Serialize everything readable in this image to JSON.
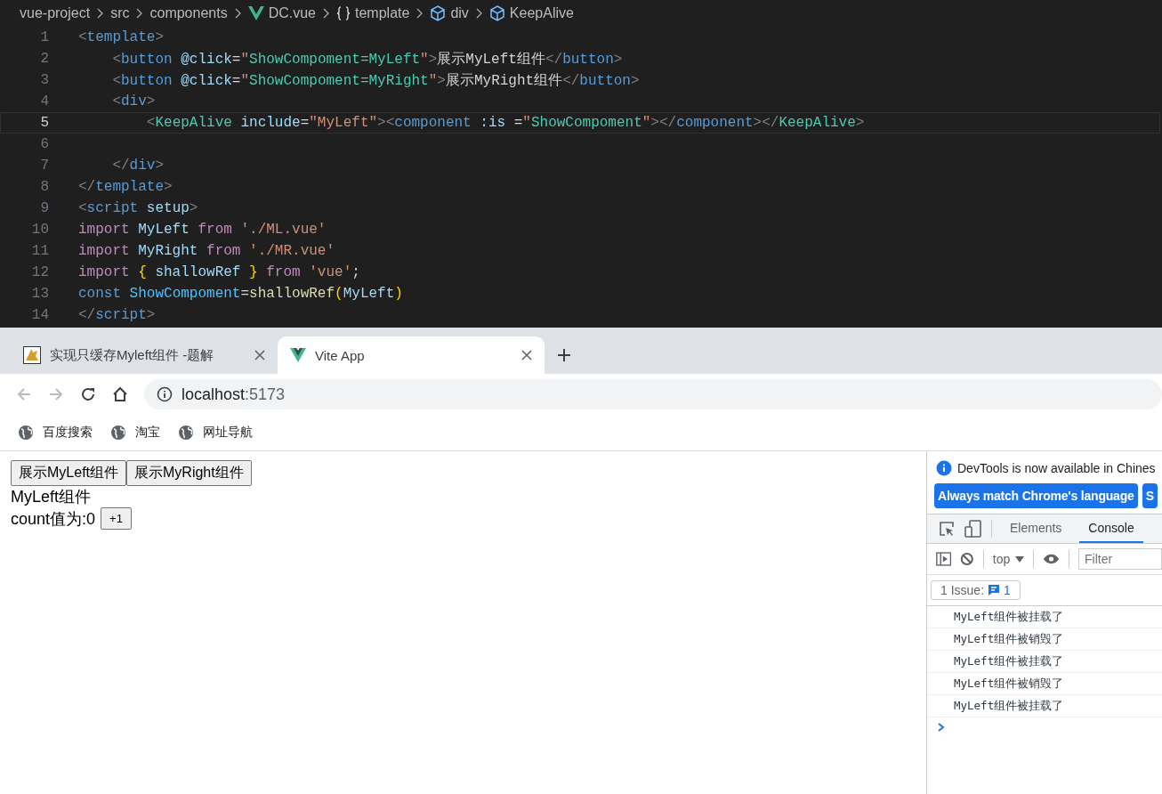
{
  "editor": {
    "breadcrumbs": [
      {
        "label": "vue-project",
        "kind": "folder"
      },
      {
        "label": "src",
        "kind": "folder"
      },
      {
        "label": "components",
        "kind": "folder"
      },
      {
        "label": "DC.vue",
        "kind": "vue"
      },
      {
        "label": "template",
        "kind": "braces"
      },
      {
        "label": "div",
        "kind": "cube"
      },
      {
        "label": "KeepAlive",
        "kind": "cube"
      }
    ],
    "lines": [
      {
        "number": "1",
        "current": false,
        "tokens": [
          {
            "kind": "punct",
            "text": "<"
          },
          {
            "kind": "tag",
            "text": "template"
          },
          {
            "kind": "punct",
            "text": ">"
          }
        ]
      },
      {
        "number": "2",
        "current": false,
        "tokens": [
          {
            "kind": "punct",
            "text": "    <"
          },
          {
            "kind": "tag",
            "text": "button"
          },
          {
            "kind": "attr",
            "text": " @click"
          },
          {
            "kind": "text",
            "text": "="
          },
          {
            "kind": "string",
            "text": "\""
          },
          {
            "kind": "expr",
            "text": "ShowCompoment=MyLeft"
          },
          {
            "kind": "string",
            "text": "\""
          },
          {
            "kind": "punct",
            "text": ">"
          },
          {
            "kind": "text",
            "text": "展示MyLeft组件"
          },
          {
            "kind": "punct",
            "text": "</"
          },
          {
            "kind": "tag",
            "text": "button"
          },
          {
            "kind": "punct",
            "text": ">"
          }
        ]
      },
      {
        "number": "3",
        "current": false,
        "tokens": [
          {
            "kind": "punct",
            "text": "    <"
          },
          {
            "kind": "tag",
            "text": "button"
          },
          {
            "kind": "attr",
            "text": " @click"
          },
          {
            "kind": "text",
            "text": "="
          },
          {
            "kind": "string",
            "text": "\""
          },
          {
            "kind": "expr",
            "text": "ShowCompoment=MyRight"
          },
          {
            "kind": "string",
            "text": "\""
          },
          {
            "kind": "punct",
            "text": ">"
          },
          {
            "kind": "text",
            "text": "展示MyRight组件"
          },
          {
            "kind": "punct",
            "text": "</"
          },
          {
            "kind": "tag",
            "text": "button"
          },
          {
            "kind": "punct",
            "text": ">"
          }
        ]
      },
      {
        "number": "4",
        "current": false,
        "tokens": [
          {
            "kind": "punct",
            "text": "    <"
          },
          {
            "kind": "tag",
            "text": "div"
          },
          {
            "kind": "punct",
            "text": ">"
          }
        ]
      },
      {
        "number": "5",
        "current": true,
        "tokens": [
          {
            "kind": "punct",
            "text": "        <"
          },
          {
            "kind": "component",
            "text": "KeepAlive"
          },
          {
            "kind": "attr",
            "text": " include"
          },
          {
            "kind": "text",
            "text": "="
          },
          {
            "kind": "string",
            "text": "\"MyLeft\""
          },
          {
            "kind": "punct",
            "text": "><"
          },
          {
            "kind": "tag",
            "text": "component"
          },
          {
            "kind": "attr",
            "text": " :is"
          },
          {
            "kind": "text",
            "text": " ="
          },
          {
            "kind": "string",
            "text": "\""
          },
          {
            "kind": "expr",
            "text": "ShowCompoment"
          },
          {
            "kind": "string",
            "text": "\""
          },
          {
            "kind": "punct",
            "text": "></"
          },
          {
            "kind": "tag",
            "text": "component"
          },
          {
            "kind": "punct",
            "text": "></"
          },
          {
            "kind": "component",
            "text": "KeepAlive"
          },
          {
            "kind": "punct",
            "text": ">"
          }
        ]
      },
      {
        "number": "6",
        "current": false
      },
      {
        "number": "7",
        "current": false,
        "tokens": [
          {
            "kind": "punct",
            "text": "    </"
          },
          {
            "kind": "tag",
            "text": "div"
          },
          {
            "kind": "punct",
            "text": ">"
          }
        ]
      },
      {
        "number": "8",
        "current": false,
        "tokens": [
          {
            "kind": "punct",
            "text": "</"
          },
          {
            "kind": "tag",
            "text": "template"
          },
          {
            "kind": "punct",
            "text": ">"
          }
        ]
      },
      {
        "number": "9",
        "current": false,
        "tokens": [
          {
            "kind": "punct",
            "text": "<"
          },
          {
            "kind": "tag",
            "text": "script"
          },
          {
            "kind": "attr",
            "text": " setup"
          },
          {
            "kind": "punct",
            "text": ">"
          }
        ]
      },
      {
        "number": "10",
        "current": false,
        "tokens": [
          {
            "kind": "keyword",
            "text": "import"
          },
          {
            "kind": "variable",
            "text": " MyLeft"
          },
          {
            "kind": "keyword",
            "text": " from"
          },
          {
            "kind": "string",
            "text": " './ML.vue'"
          }
        ]
      },
      {
        "number": "11",
        "current": false,
        "tokens": [
          {
            "kind": "keyword",
            "text": "import"
          },
          {
            "kind": "variable",
            "text": " MyRight"
          },
          {
            "kind": "keyword",
            "text": " from"
          },
          {
            "kind": "string",
            "text": " './MR.vue'"
          }
        ]
      },
      {
        "number": "12",
        "current": false,
        "tokens": [
          {
            "kind": "keyword",
            "text": "import"
          },
          {
            "kind": "bracket",
            "text": " {"
          },
          {
            "kind": "variable",
            "text": " shallowRef"
          },
          {
            "kind": "bracket",
            "text": " }"
          },
          {
            "kind": "keyword",
            "text": " from"
          },
          {
            "kind": "string",
            "text": " 'vue'"
          },
          {
            "kind": "text",
            "text": ";"
          }
        ]
      },
      {
        "number": "13",
        "current": false,
        "tokens": [
          {
            "kind": "storage",
            "text": "const"
          },
          {
            "kind": "constant",
            "text": " ShowCompoment"
          },
          {
            "kind": "text",
            "text": "="
          },
          {
            "kind": "function",
            "text": "shallowRef"
          },
          {
            "kind": "bracket",
            "text": "("
          },
          {
            "kind": "variable",
            "text": "MyLeft"
          },
          {
            "kind": "bracket",
            "text": ")"
          }
        ]
      },
      {
        "number": "14",
        "current": false,
        "tokens": [
          {
            "kind": "punct",
            "text": "</"
          },
          {
            "kind": "tag",
            "text": "script"
          },
          {
            "kind": "punct",
            "text": ">"
          }
        ]
      }
    ]
  },
  "browser": {
    "tabs": [
      {
        "title": "实现只缓存Myleft组件 -题解",
        "kind": "cat",
        "selected": false
      },
      {
        "title": "Vite App",
        "kind": "vue",
        "selected": true
      }
    ],
    "address": {
      "host": "localhost",
      "port": ":5173"
    },
    "bookmarks": [
      "百度搜索",
      "淘宝",
      "网址导航"
    ],
    "page": {
      "buttons": [
        "展示MyLeft组件",
        "展示MyRight组件"
      ],
      "heading": "MyLeft组件",
      "count_label": "count值为:0",
      "increment_button": "+1"
    },
    "devtools": {
      "notice": "DevTools is now available in Chines",
      "notice_buttons": [
        "Always match Chrome's language",
        "S"
      ],
      "tabs": [
        {
          "label": "Elements",
          "selected": false
        },
        {
          "label": "Console",
          "selected": true
        }
      ],
      "context": "top",
      "filter_placeholder": "Filter",
      "issues_label": "1 Issue:",
      "issues_count": "1",
      "logs": [
        "MyLeft组件被挂载了",
        "MyLeft组件被销毁了",
        "MyLeft组件被挂载了",
        "MyLeft组件被销毁了",
        "MyLeft组件被挂载了"
      ]
    }
  }
}
